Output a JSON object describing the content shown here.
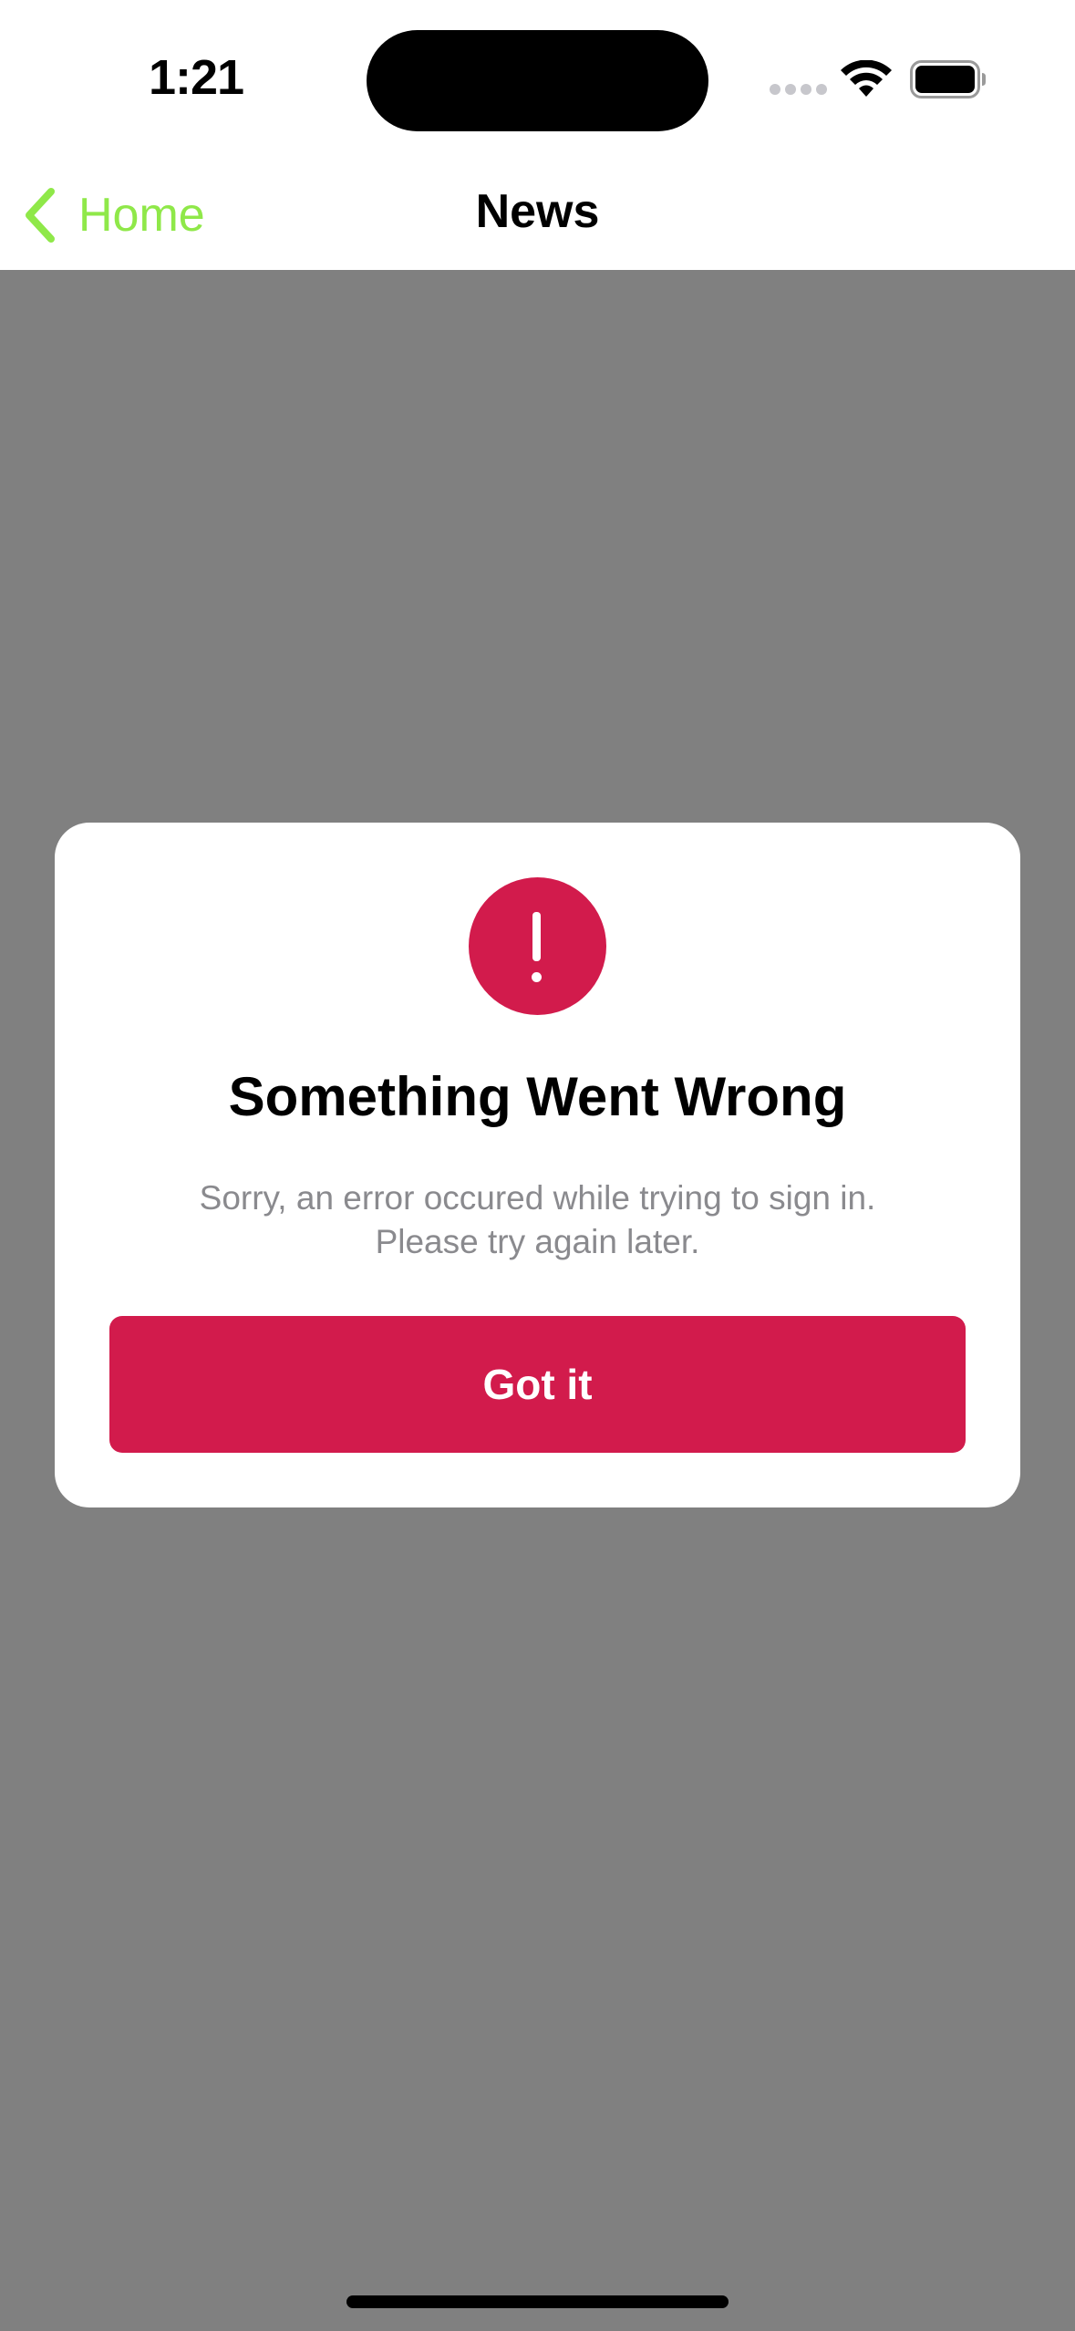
{
  "status_bar": {
    "time": "1:21"
  },
  "nav": {
    "back_label": "Home",
    "title": "News"
  },
  "alert": {
    "title": "Something Went Wrong",
    "message_line1": "Sorry, an error occured while trying to sign in.",
    "message_line2": "Please try again later.",
    "button_label": "Got it"
  },
  "colors": {
    "accent_back": "#8fe849",
    "error_red": "#d21b4c",
    "backdrop": "#808080"
  },
  "icons": {
    "back": "chevron-left-icon",
    "alert": "exclamation-icon",
    "wifi": "wifi-icon",
    "battery": "battery-icon",
    "signal": "cellular-signal-icon"
  }
}
